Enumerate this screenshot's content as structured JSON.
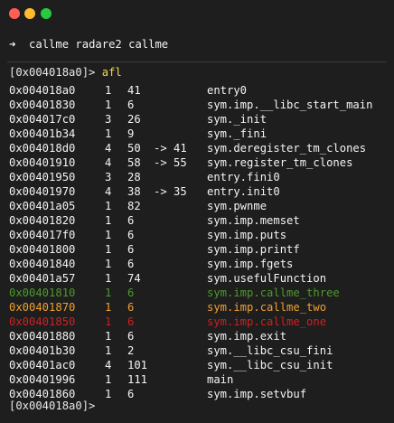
{
  "window": {
    "traffic_lights": {
      "close_color": "#ff5f56",
      "minimize_color": "#ffbd2e",
      "maximize_color": "#27c93f"
    }
  },
  "shell": {
    "arrow": "➜",
    "directory": "callme",
    "command": "radare2 callme"
  },
  "r2": {
    "prompt": "[0x004018a0]>",
    "command": "afl",
    "final_prompt": "[0x004018a0]>"
  },
  "colors": {
    "background": "#1e1e1e",
    "text": "#f4f4f4",
    "command_yellow": "#f7d94c",
    "green": "#4e9a2a",
    "orange": "#f0a030",
    "red": "#d02020"
  },
  "functions": [
    {
      "addr": "0x004018a0",
      "bbs": "1",
      "size": "41",
      "xref": "",
      "name": "entry0",
      "color": "default"
    },
    {
      "addr": "0x00401830",
      "bbs": "1",
      "size": "6",
      "xref": "",
      "name": "sym.imp.__libc_start_main",
      "color": "default"
    },
    {
      "addr": "0x004017c0",
      "bbs": "3",
      "size": "26",
      "xref": "",
      "name": "sym._init",
      "color": "default"
    },
    {
      "addr": "0x00401b34",
      "bbs": "1",
      "size": "9",
      "xref": "",
      "name": "sym._fini",
      "color": "default"
    },
    {
      "addr": "0x004018d0",
      "bbs": "4",
      "size": "50",
      "xref": "-> 41",
      "name": "sym.deregister_tm_clones",
      "color": "default"
    },
    {
      "addr": "0x00401910",
      "bbs": "4",
      "size": "58",
      "xref": "-> 55",
      "name": "sym.register_tm_clones",
      "color": "default"
    },
    {
      "addr": "0x00401950",
      "bbs": "3",
      "size": "28",
      "xref": "",
      "name": "entry.fini0",
      "color": "default"
    },
    {
      "addr": "0x00401970",
      "bbs": "4",
      "size": "38",
      "xref": "-> 35",
      "name": "entry.init0",
      "color": "default"
    },
    {
      "addr": "0x00401a05",
      "bbs": "1",
      "size": "82",
      "xref": "",
      "name": "sym.pwnme",
      "color": "default"
    },
    {
      "addr": "0x00401820",
      "bbs": "1",
      "size": "6",
      "xref": "",
      "name": "sym.imp.memset",
      "color": "default"
    },
    {
      "addr": "0x004017f0",
      "bbs": "1",
      "size": "6",
      "xref": "",
      "name": "sym.imp.puts",
      "color": "default"
    },
    {
      "addr": "0x00401800",
      "bbs": "1",
      "size": "6",
      "xref": "",
      "name": "sym.imp.printf",
      "color": "default"
    },
    {
      "addr": "0x00401840",
      "bbs": "1",
      "size": "6",
      "xref": "",
      "name": "sym.imp.fgets",
      "color": "default"
    },
    {
      "addr": "0x00401a57",
      "bbs": "1",
      "size": "74",
      "xref": "",
      "name": "sym.usefulFunction",
      "color": "default"
    },
    {
      "addr": "0x00401810",
      "bbs": "1",
      "size": "6",
      "xref": "",
      "name": "sym.imp.callme_three",
      "color": "green"
    },
    {
      "addr": "0x00401870",
      "bbs": "1",
      "size": "6",
      "xref": "",
      "name": "sym.imp.callme_two",
      "color": "orange"
    },
    {
      "addr": "0x00401850",
      "bbs": "1",
      "size": "6",
      "xref": "",
      "name": "sym.imp.callme_one",
      "color": "red"
    },
    {
      "addr": "0x00401880",
      "bbs": "1",
      "size": "6",
      "xref": "",
      "name": "sym.imp.exit",
      "color": "default"
    },
    {
      "addr": "0x00401b30",
      "bbs": "1",
      "size": "2",
      "xref": "",
      "name": "sym.__libc_csu_fini",
      "color": "default"
    },
    {
      "addr": "0x00401ac0",
      "bbs": "4",
      "size": "101",
      "xref": "",
      "name": "sym.__libc_csu_init",
      "color": "default"
    },
    {
      "addr": "0x00401996",
      "bbs": "1",
      "size": "111",
      "xref": "",
      "name": "main",
      "color": "default"
    },
    {
      "addr": "0x00401860",
      "bbs": "1",
      "size": "6",
      "xref": "",
      "name": "sym.imp.setvbuf",
      "color": "default"
    }
  ]
}
